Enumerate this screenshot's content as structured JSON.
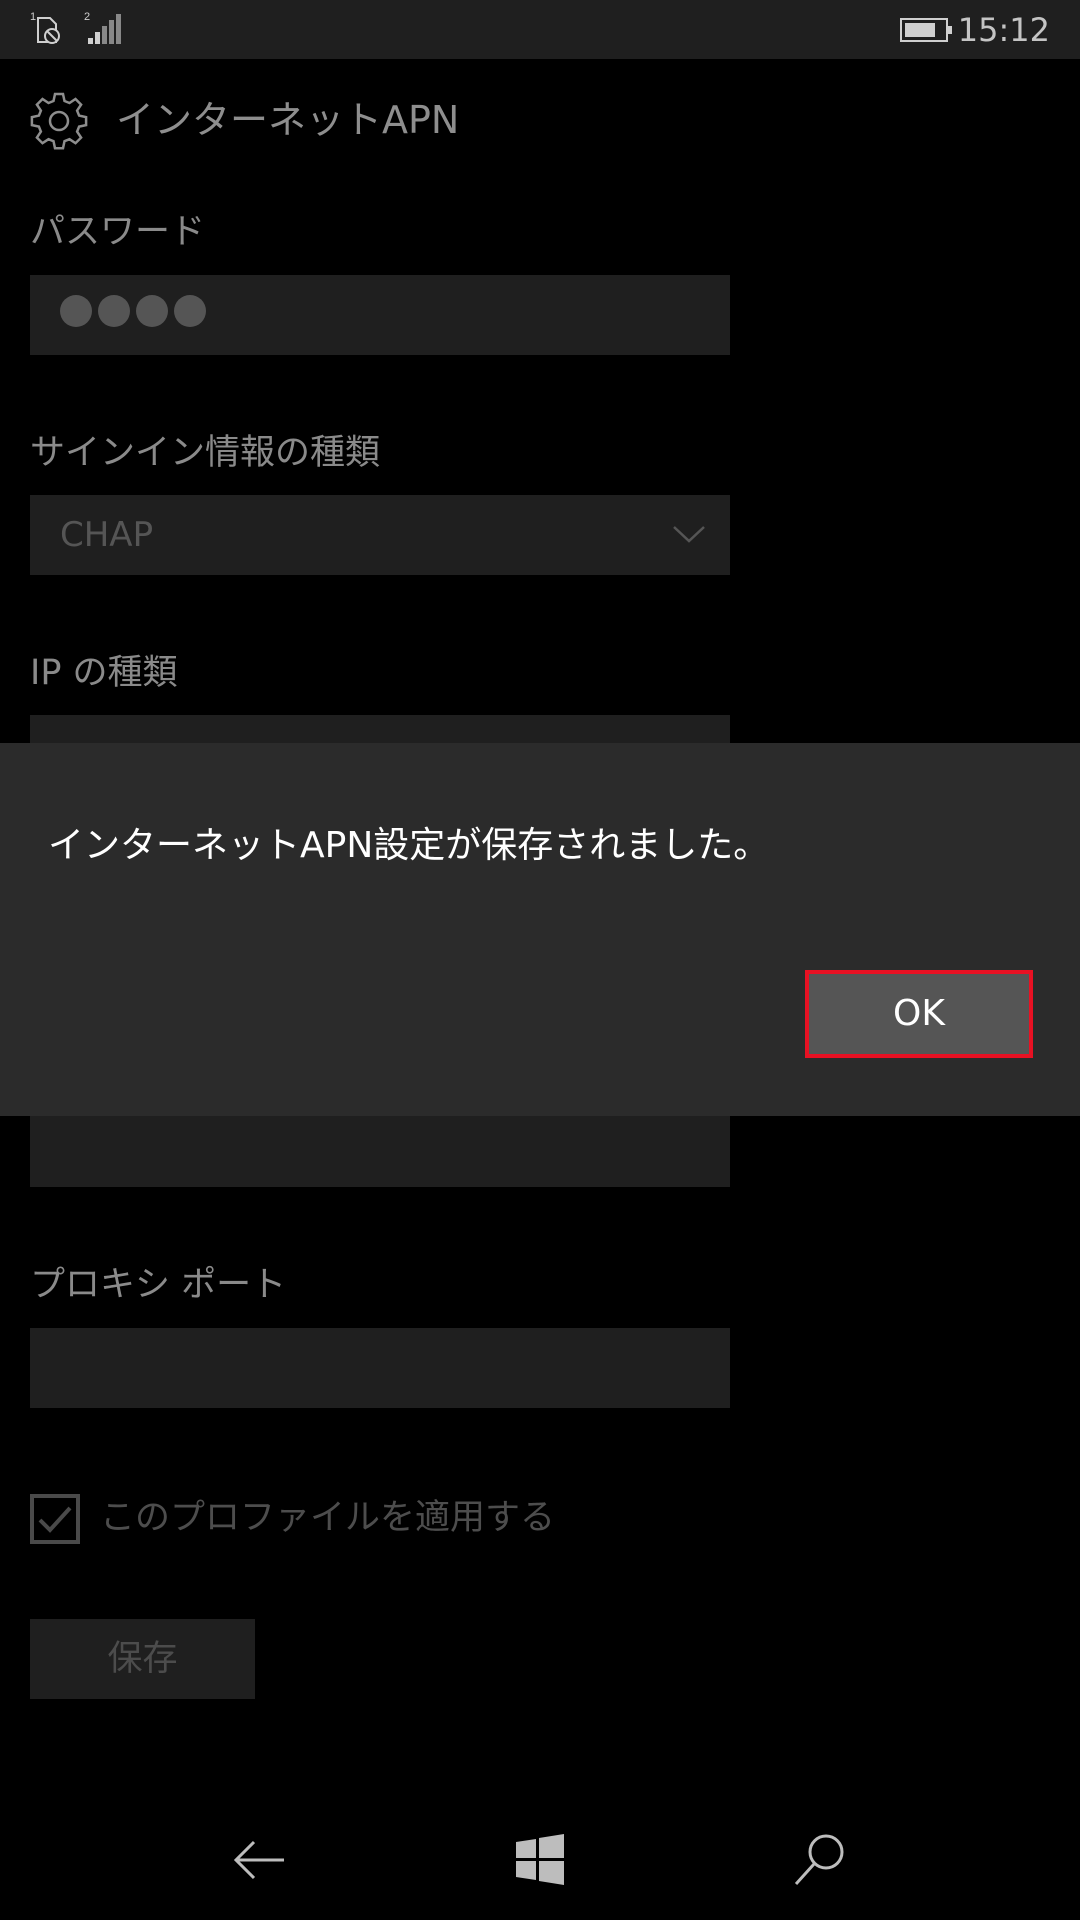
{
  "status_bar": {
    "sim1_label": "1",
    "sim2_label": "2",
    "time": "15:12",
    "icons": [
      "sim1-no-service-icon",
      "sim2-signal-icon",
      "battery-icon"
    ]
  },
  "header": {
    "title": "インターネットAPN",
    "icon": "gear-icon"
  },
  "form": {
    "password": {
      "label": "パスワード",
      "masked_length": 4
    },
    "signin_type": {
      "label": "サインイン情報の種類",
      "value": "CHAP"
    },
    "ip_type": {
      "label": "IP の種類"
    },
    "proxy_port": {
      "label": "プロキシ ポート",
      "value": ""
    },
    "apply_profile": {
      "label": "このプロファイルを適用する",
      "checked": true
    },
    "save_label": "保存"
  },
  "dialog": {
    "message": "インターネットAPN設定が保存されました。",
    "ok_label": "OK",
    "ok_highlight_color": "#e81123"
  },
  "nav_bar": {
    "icons": [
      "back-arrow-icon",
      "windows-start-icon",
      "search-icon"
    ]
  }
}
